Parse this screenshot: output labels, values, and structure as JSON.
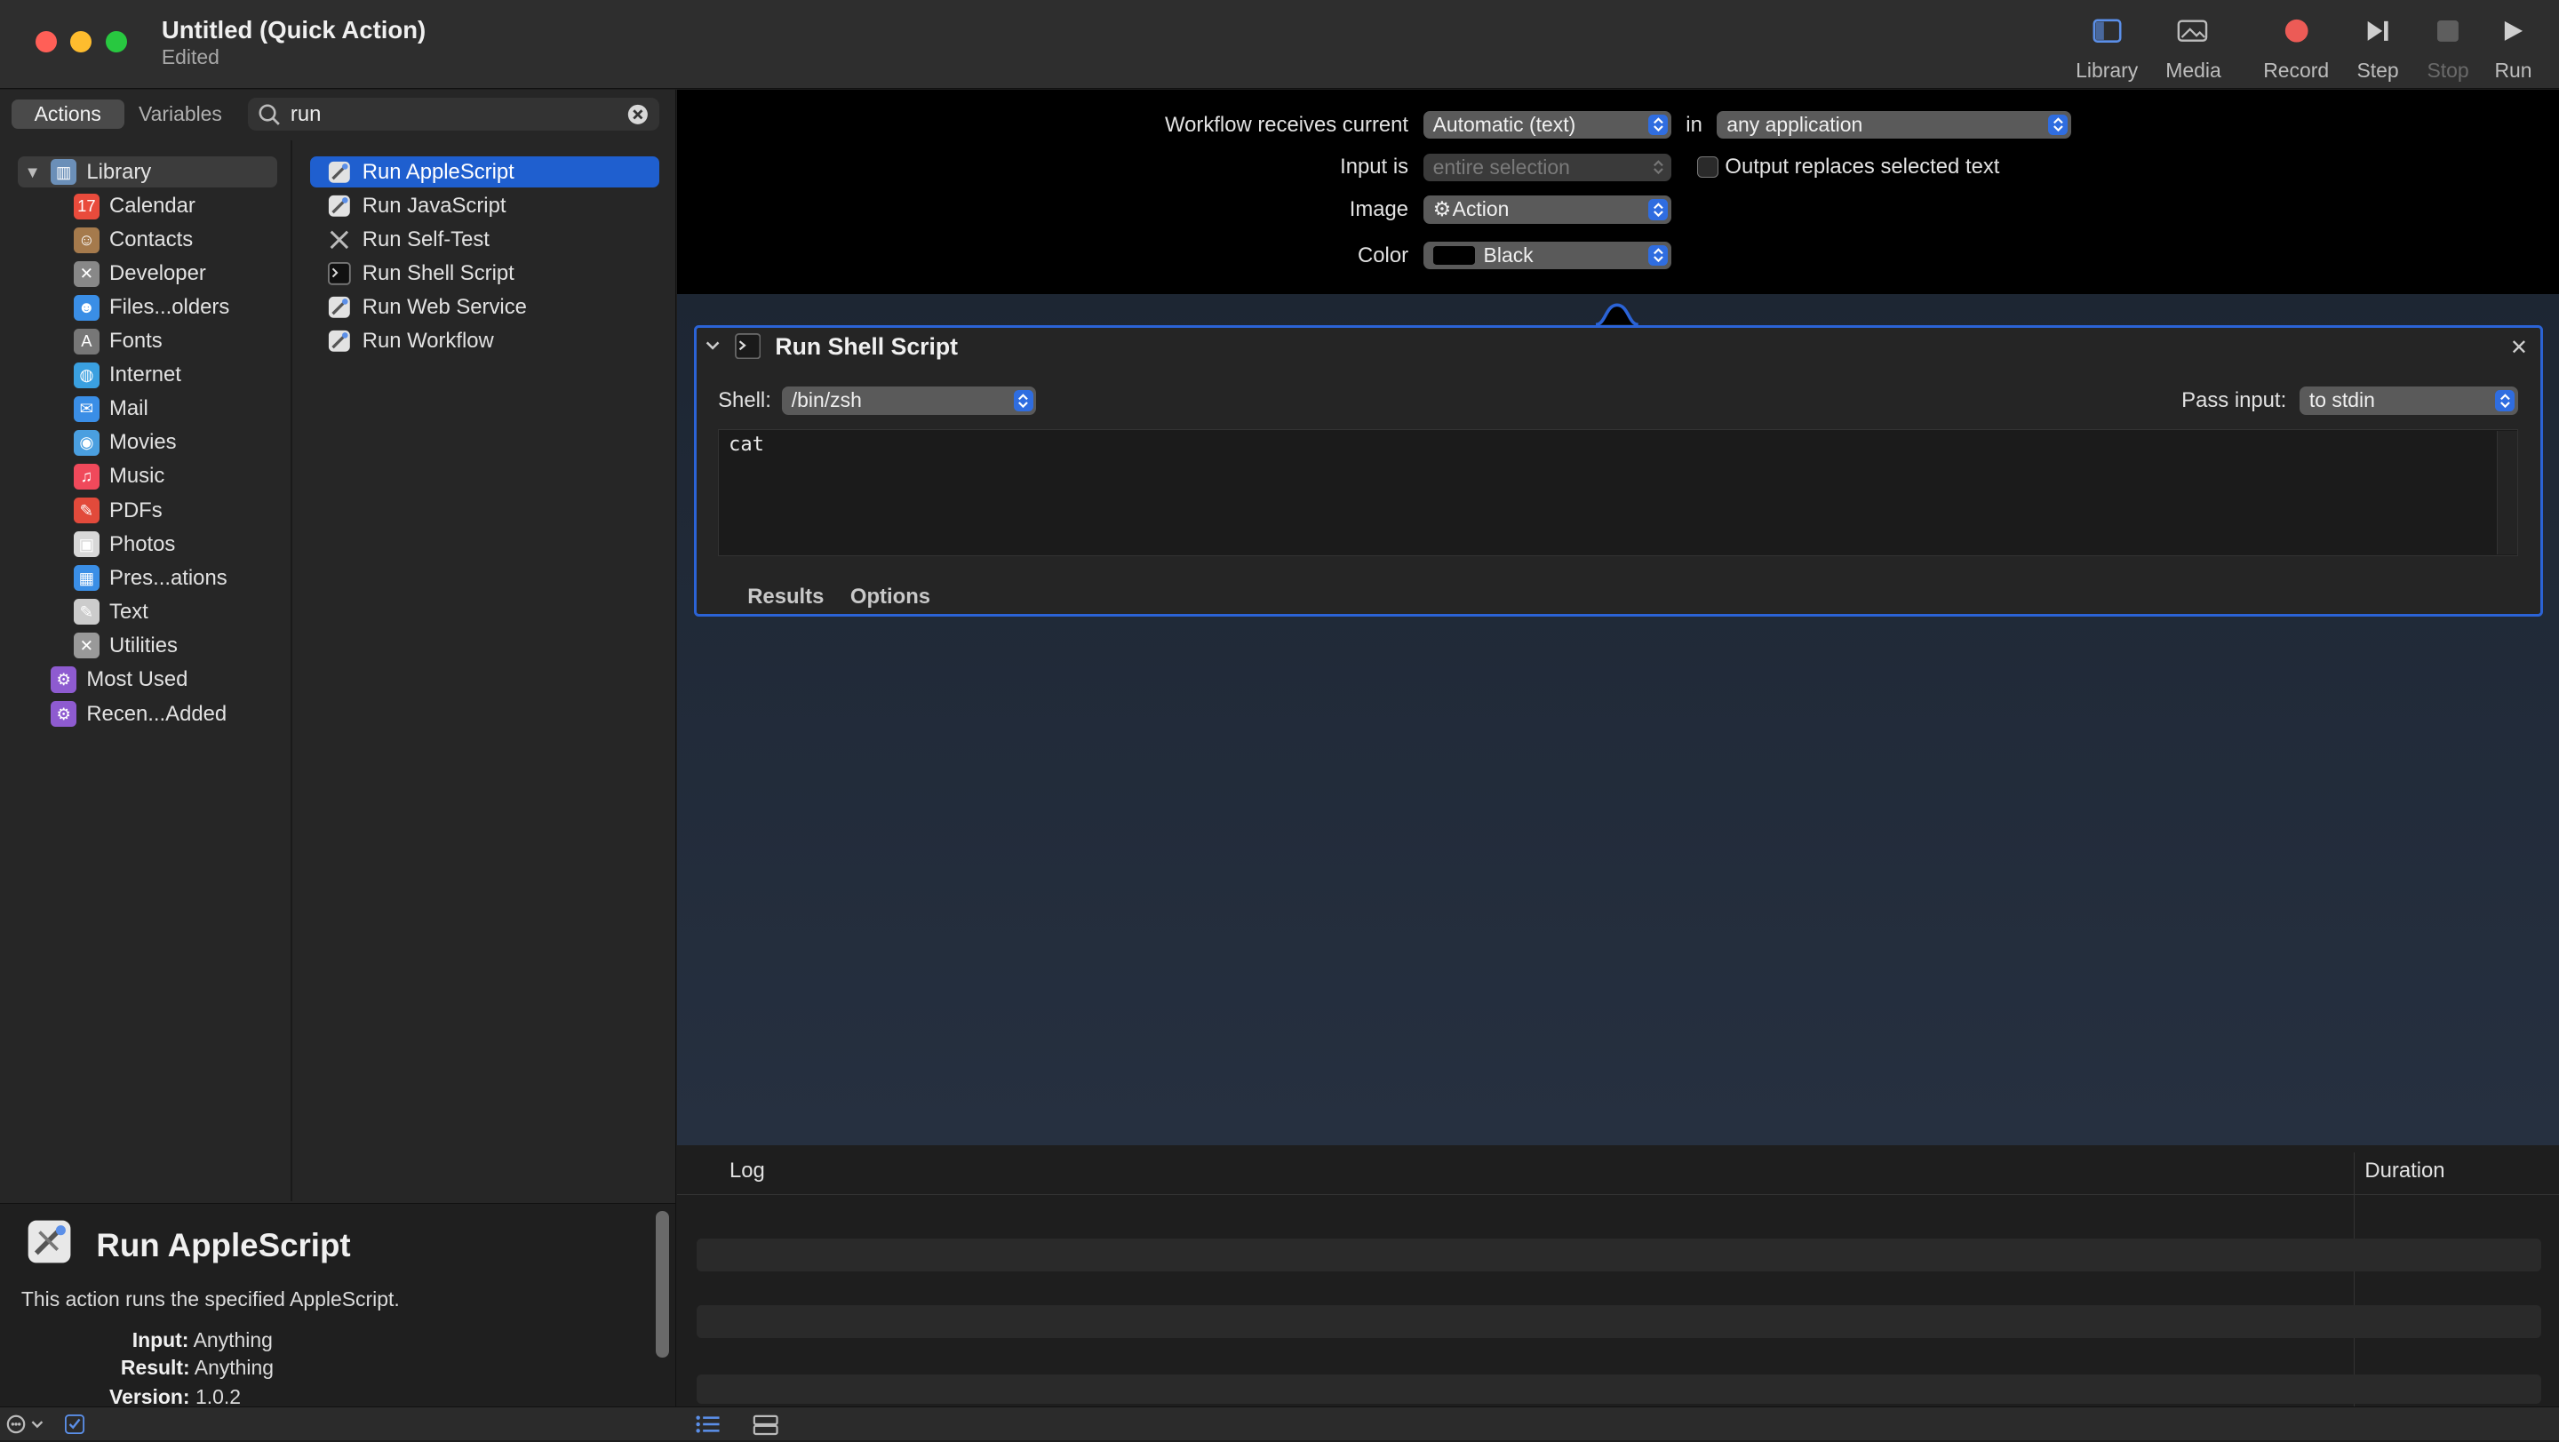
{
  "window": {
    "title": "Untitled (Quick Action)",
    "subtitle": "Edited"
  },
  "toolbar": {
    "library": "Library",
    "media": "Media",
    "record": "Record",
    "step": "Step",
    "stop": "Stop",
    "run": "Run"
  },
  "sidebar": {
    "tabs": {
      "actions": "Actions",
      "variables": "Variables"
    },
    "search_value": "run",
    "library_root": "Library",
    "categories": [
      {
        "label": "Calendar",
        "icon": "calendar-icon",
        "color": "#e94b3c"
      },
      {
        "label": "Contacts",
        "icon": "contacts-icon",
        "color": "#a57a4c"
      },
      {
        "label": "Developer",
        "icon": "developer-icon",
        "color": "#888888"
      },
      {
        "label": "Files...olders",
        "icon": "finder-icon",
        "color": "#3a8ee6"
      },
      {
        "label": "Fonts",
        "icon": "fonts-icon",
        "color": "#777777"
      },
      {
        "label": "Internet",
        "icon": "internet-icon",
        "color": "#3aa0e0"
      },
      {
        "label": "Mail",
        "icon": "mail-icon",
        "color": "#3a8ee6"
      },
      {
        "label": "Movies",
        "icon": "movies-icon",
        "color": "#4a9fe0"
      },
      {
        "label": "Music",
        "icon": "music-icon",
        "color": "#f0495b"
      },
      {
        "label": "PDFs",
        "icon": "pdf-icon",
        "color": "#e24a3b"
      },
      {
        "label": "Photos",
        "icon": "photos-icon",
        "color": "#d8d8d8"
      },
      {
        "label": "Pres...ations",
        "icon": "presentations-icon",
        "color": "#3a8ee6"
      },
      {
        "label": "Text",
        "icon": "text-icon",
        "color": "#cccccc"
      },
      {
        "label": "Utilities",
        "icon": "utilities-icon",
        "color": "#999999"
      }
    ],
    "smart_groups": [
      {
        "label": "Most Used",
        "icon": "smart-folder-icon"
      },
      {
        "label": "Recen...Added",
        "icon": "smart-folder-icon"
      }
    ],
    "actions": [
      {
        "label": "Run AppleScript",
        "icon": "applescript-icon",
        "selected": true
      },
      {
        "label": "Run JavaScript",
        "icon": "javascript-icon"
      },
      {
        "label": "Run Self-Test",
        "icon": "self-test-icon"
      },
      {
        "label": "Run Shell Script",
        "icon": "terminal-icon"
      },
      {
        "label": "Run Web Service",
        "icon": "web-service-icon"
      },
      {
        "label": "Run Workflow",
        "icon": "workflow-icon"
      }
    ]
  },
  "description": {
    "title": "Run AppleScript",
    "text": "This action runs the specified AppleScript.",
    "input_label": "Input:",
    "input_value": "Anything",
    "result_label": "Result:",
    "result_value": "Anything",
    "version_label": "Version:",
    "version_value": "1.0.2"
  },
  "workflow_header": {
    "receives_label": "Workflow receives current",
    "receives_value": "Automatic (text)",
    "in_label": "in",
    "app_value": "any application",
    "input_is_label": "Input is",
    "input_is_value": "entire selection",
    "output_replaces_label": "Output replaces selected text",
    "output_replaces_checked": false,
    "image_label": "Image",
    "image_value": "Action",
    "color_label": "Color",
    "color_value": "Black"
  },
  "action_card": {
    "title": "Run Shell Script",
    "shell_label": "Shell:",
    "shell_value": "/bin/zsh",
    "pass_input_label": "Pass input:",
    "pass_input_value": "to stdin",
    "script": "cat",
    "tabs": {
      "results": "Results",
      "options": "Options"
    }
  },
  "log": {
    "title": "Log",
    "duration": "Duration"
  },
  "colors": {
    "accent": "#2b63d6",
    "selection": "#1f5fcf",
    "record": "#ec5b56"
  }
}
